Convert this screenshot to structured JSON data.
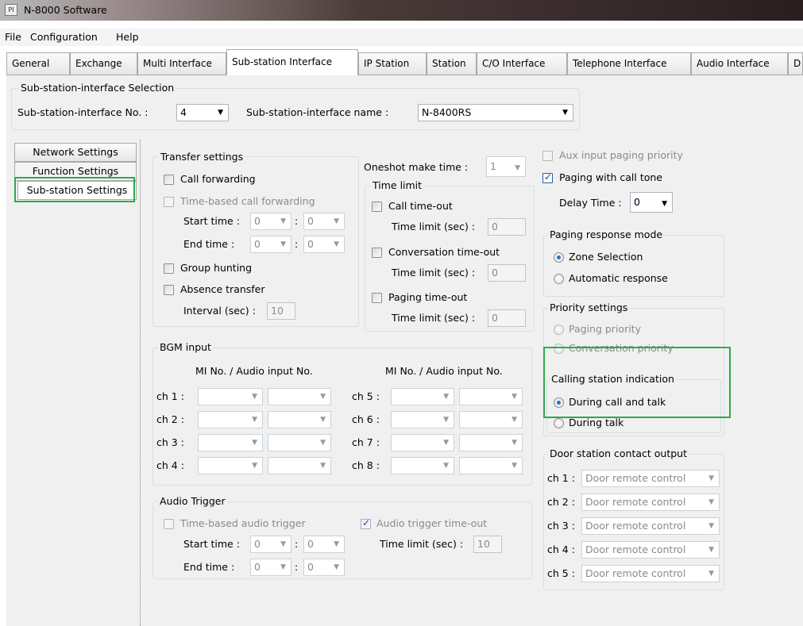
{
  "window": {
    "title": "N-8000 Software",
    "icon_text": "PI"
  },
  "menu": [
    "File",
    "Configuration",
    "Help"
  ],
  "tabs": [
    "General",
    "Exchange",
    "Multi Interface",
    "Sub-station Interface",
    "IP Station",
    "Station",
    "C/O Interface",
    "Telephone Interface",
    "Audio Interface",
    "D"
  ],
  "active_tab": "Sub-station Interface",
  "selection": {
    "group_label": "Sub-station-interface Selection",
    "no_label": "Sub-station-interface  No. :",
    "no_value": "4",
    "name_label": "Sub-station-interface  name :",
    "name_value": "N-8400RS"
  },
  "side_tabs": [
    "Network Settings",
    "Function Settings",
    "Sub-station Settings"
  ],
  "transfer": {
    "label": "Transfer settings",
    "call_forwarding": "Call forwarding",
    "time_based": "Time-based call forwarding",
    "start_time": "Start time :",
    "end_time": "End time  :",
    "time_val": "0",
    "colon": ":",
    "group_hunting": "Group hunting",
    "absence_transfer": "Absence transfer",
    "interval_label": "Interval (sec) :",
    "interval_value": "10"
  },
  "oneshot": {
    "label": "Oneshot make time :",
    "value": "1"
  },
  "time_limit": {
    "label": "Time limit",
    "call_timeout": "Call time-out",
    "conversation_timeout": "Conversation time-out",
    "paging_timeout": "Paging time-out",
    "limit_label": "Time limit (sec) :",
    "limit_value": "0"
  },
  "right": {
    "aux_input": "Aux input paging priority",
    "paging_call_tone": "Paging with call tone",
    "delay_label": "Delay Time :",
    "delay_value": "0",
    "paging_response": "Paging response mode",
    "zone_selection": "Zone Selection",
    "automatic_response": "Automatic response",
    "priority_settings": "Priority settings",
    "paging_priority": "Paging priority",
    "conversation_priority": "Conversation priority",
    "calling_indication": "Calling station indication",
    "during_call_talk": "During call and talk",
    "during_talk": "During talk",
    "door_contact": "Door station contact output",
    "door_value": "Door remote control"
  },
  "door_channels": [
    "ch 1 :",
    "ch 2 :",
    "ch 3 :",
    "ch 4 :",
    "ch 5 :"
  ],
  "bgm": {
    "label": "BGM input",
    "col_header": "MI No. / Audio input No.",
    "left_channels": [
      "ch 1 :",
      "ch 2 :",
      "ch 3 :",
      "ch 4 :"
    ],
    "right_channels": [
      "ch 5 :",
      "ch 6 :",
      "ch 7 :",
      "ch 8 :"
    ]
  },
  "audio_trigger": {
    "label": "Audio Trigger",
    "time_based": "Time-based audio trigger",
    "timeout": "Audio trigger time-out",
    "start_time": "Start time :",
    "end_time": "End time  :",
    "limit_label": "Time limit (sec) :",
    "limit_value": "10",
    "time_val": "0"
  },
  "colors": {
    "highlight": "#2eaa4a",
    "radio_selected": "#2d6ecf",
    "check": "#23468a"
  }
}
